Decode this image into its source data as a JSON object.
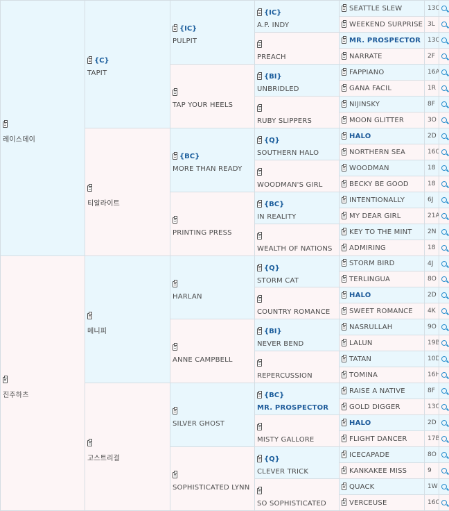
{
  "pedigree": [
    {
      "gen": 1,
      "idx": 0,
      "name": "레이스데이",
      "tag": "",
      "sex": "m",
      "hl": false
    },
    {
      "gen": 1,
      "idx": 1,
      "name": "진주하츠",
      "tag": "",
      "sex": "f",
      "hl": false
    },
    {
      "gen": 2,
      "idx": 0,
      "name": "TAPIT",
      "tag": "{C}",
      "sex": "m",
      "hl": false
    },
    {
      "gen": 2,
      "idx": 1,
      "name": "티알라이트",
      "tag": "",
      "sex": "f",
      "hl": false
    },
    {
      "gen": 2,
      "idx": 2,
      "name": "메니피",
      "tag": "",
      "sex": "m",
      "hl": false
    },
    {
      "gen": 2,
      "idx": 3,
      "name": "고스트리걸",
      "tag": "",
      "sex": "f",
      "hl": false
    },
    {
      "gen": 3,
      "idx": 0,
      "name": "PULPIT",
      "tag": "{IC}",
      "sex": "m",
      "hl": false
    },
    {
      "gen": 3,
      "idx": 1,
      "name": "TAP YOUR HEELS",
      "tag": "",
      "sex": "f",
      "hl": false
    },
    {
      "gen": 3,
      "idx": 2,
      "name": "MORE THAN READY",
      "tag": "{BC}",
      "sex": "m",
      "hl": false
    },
    {
      "gen": 3,
      "idx": 3,
      "name": "PRINTING PRESS",
      "tag": "",
      "sex": "f",
      "hl": false
    },
    {
      "gen": 3,
      "idx": 4,
      "name": "HARLAN",
      "tag": "",
      "sex": "m",
      "hl": false
    },
    {
      "gen": 3,
      "idx": 5,
      "name": "ANNE CAMPBELL",
      "tag": "",
      "sex": "f",
      "hl": false
    },
    {
      "gen": 3,
      "idx": 6,
      "name": "SILVER GHOST",
      "tag": "",
      "sex": "m",
      "hl": false
    },
    {
      "gen": 3,
      "idx": 7,
      "name": "SOPHISTICATED LYNN",
      "tag": "",
      "sex": "f",
      "hl": false
    },
    {
      "gen": 4,
      "idx": 0,
      "name": "A.P. INDY",
      "tag": "{IC}",
      "sex": "m",
      "hl": false
    },
    {
      "gen": 4,
      "idx": 1,
      "name": "PREACH",
      "tag": "",
      "sex": "f",
      "hl": false
    },
    {
      "gen": 4,
      "idx": 2,
      "name": "UNBRIDLED",
      "tag": "{BI}",
      "sex": "m",
      "hl": false
    },
    {
      "gen": 4,
      "idx": 3,
      "name": "RUBY SLIPPERS",
      "tag": "",
      "sex": "f",
      "hl": false
    },
    {
      "gen": 4,
      "idx": 4,
      "name": "SOUTHERN HALO",
      "tag": "{Q}",
      "sex": "m",
      "hl": false
    },
    {
      "gen": 4,
      "idx": 5,
      "name": "WOODMAN'S GIRL",
      "tag": "",
      "sex": "f",
      "hl": false
    },
    {
      "gen": 4,
      "idx": 6,
      "name": "IN REALITY",
      "tag": "{BC}",
      "sex": "m",
      "hl": false
    },
    {
      "gen": 4,
      "idx": 7,
      "name": "WEALTH OF NATIONS",
      "tag": "",
      "sex": "f",
      "hl": false
    },
    {
      "gen": 4,
      "idx": 8,
      "name": "STORM CAT",
      "tag": "{Q}",
      "sex": "m",
      "hl": false
    },
    {
      "gen": 4,
      "idx": 9,
      "name": "COUNTRY ROMANCE",
      "tag": "",
      "sex": "f",
      "hl": false
    },
    {
      "gen": 4,
      "idx": 10,
      "name": "NEVER BEND",
      "tag": "{BI}",
      "sex": "m",
      "hl": false
    },
    {
      "gen": 4,
      "idx": 11,
      "name": "REPERCUSSION",
      "tag": "",
      "sex": "f",
      "hl": false
    },
    {
      "gen": 4,
      "idx": 12,
      "name": "MR. PROSPECTOR",
      "tag": "{BC}",
      "sex": "m",
      "hl": true
    },
    {
      "gen": 4,
      "idx": 13,
      "name": "MISTY GALLORE",
      "tag": "",
      "sex": "f",
      "hl": false
    },
    {
      "gen": 4,
      "idx": 14,
      "name": "CLEVER TRICK",
      "tag": "{Q}",
      "sex": "m",
      "hl": false
    },
    {
      "gen": 4,
      "idx": 15,
      "name": "SO SOPHISTICATED",
      "tag": "",
      "sex": "f",
      "hl": false
    },
    {
      "gen": 5,
      "idx": 0,
      "name": "SEATTLE SLEW",
      "tag": "",
      "sex": "m",
      "hl": false,
      "code": "13C"
    },
    {
      "gen": 5,
      "idx": 1,
      "name": "WEEKEND SURPRISE",
      "tag": "",
      "sex": "f",
      "hl": false,
      "code": "3L"
    },
    {
      "gen": 5,
      "idx": 2,
      "name": "MR. PROSPECTOR",
      "tag": "",
      "sex": "m",
      "hl": true,
      "code": "13C"
    },
    {
      "gen": 5,
      "idx": 3,
      "name": "NARRATE",
      "tag": "",
      "sex": "f",
      "hl": false,
      "code": "2F"
    },
    {
      "gen": 5,
      "idx": 4,
      "name": "FAPPIANO",
      "tag": "",
      "sex": "m",
      "hl": false,
      "code": "16A"
    },
    {
      "gen": 5,
      "idx": 5,
      "name": "GANA FACIL",
      "tag": "",
      "sex": "f",
      "hl": false,
      "code": "1R"
    },
    {
      "gen": 5,
      "idx": 6,
      "name": "NIJINSKY",
      "tag": "",
      "sex": "m",
      "hl": false,
      "code": "8F"
    },
    {
      "gen": 5,
      "idx": 7,
      "name": "MOON GLITTER",
      "tag": "",
      "sex": "f",
      "hl": false,
      "code": "3O"
    },
    {
      "gen": 5,
      "idx": 8,
      "name": "HALO",
      "tag": "",
      "sex": "m",
      "hl": true,
      "code": "2D"
    },
    {
      "gen": 5,
      "idx": 9,
      "name": "NORTHERN SEA",
      "tag": "",
      "sex": "f",
      "hl": false,
      "code": "16C"
    },
    {
      "gen": 5,
      "idx": 10,
      "name": "WOODMAN",
      "tag": "",
      "sex": "m",
      "hl": false,
      "code": "18"
    },
    {
      "gen": 5,
      "idx": 11,
      "name": "BECKY BE GOOD",
      "tag": "",
      "sex": "f",
      "hl": false,
      "code": "18"
    },
    {
      "gen": 5,
      "idx": 12,
      "name": "INTENTIONALLY",
      "tag": "",
      "sex": "m",
      "hl": false,
      "code": "6J"
    },
    {
      "gen": 5,
      "idx": 13,
      "name": "MY DEAR GIRL",
      "tag": "",
      "sex": "f",
      "hl": false,
      "code": "21A"
    },
    {
      "gen": 5,
      "idx": 14,
      "name": "KEY TO THE MINT",
      "tag": "",
      "sex": "m",
      "hl": false,
      "code": "2N"
    },
    {
      "gen": 5,
      "idx": 15,
      "name": "ADMIRING",
      "tag": "",
      "sex": "f",
      "hl": false,
      "code": "18"
    },
    {
      "gen": 5,
      "idx": 16,
      "name": "STORM BIRD",
      "tag": "",
      "sex": "m",
      "hl": false,
      "code": "4J"
    },
    {
      "gen": 5,
      "idx": 17,
      "name": "TERLINGUA",
      "tag": "",
      "sex": "f",
      "hl": false,
      "code": "8O"
    },
    {
      "gen": 5,
      "idx": 18,
      "name": "HALO",
      "tag": "",
      "sex": "m",
      "hl": true,
      "code": "2D"
    },
    {
      "gen": 5,
      "idx": 19,
      "name": "SWEET ROMANCE",
      "tag": "",
      "sex": "f",
      "hl": false,
      "code": "4K"
    },
    {
      "gen": 5,
      "idx": 20,
      "name": "NASRULLAH",
      "tag": "",
      "sex": "m",
      "hl": false,
      "code": "9O"
    },
    {
      "gen": 5,
      "idx": 21,
      "name": "LALUN",
      "tag": "",
      "sex": "f",
      "hl": false,
      "code": "19B"
    },
    {
      "gen": 5,
      "idx": 22,
      "name": "TATAN",
      "tag": "",
      "sex": "m",
      "hl": false,
      "code": "10D"
    },
    {
      "gen": 5,
      "idx": 23,
      "name": "TOMINA",
      "tag": "",
      "sex": "f",
      "hl": false,
      "code": "16H"
    },
    {
      "gen": 5,
      "idx": 24,
      "name": "RAISE A NATIVE",
      "tag": "",
      "sex": "m",
      "hl": false,
      "code": "8F"
    },
    {
      "gen": 5,
      "idx": 25,
      "name": "GOLD DIGGER",
      "tag": "",
      "sex": "f",
      "hl": false,
      "code": "13C"
    },
    {
      "gen": 5,
      "idx": 26,
      "name": "HALO",
      "tag": "",
      "sex": "m",
      "hl": true,
      "code": "2D"
    },
    {
      "gen": 5,
      "idx": 27,
      "name": "FLIGHT DANCER",
      "tag": "",
      "sex": "f",
      "hl": false,
      "code": "17B"
    },
    {
      "gen": 5,
      "idx": 28,
      "name": "ICECAPADE",
      "tag": "",
      "sex": "m",
      "hl": false,
      "code": "8O"
    },
    {
      "gen": 5,
      "idx": 29,
      "name": "KANKAKEE MISS",
      "tag": "",
      "sex": "f",
      "hl": false,
      "code": "9"
    },
    {
      "gen": 5,
      "idx": 30,
      "name": "QUACK",
      "tag": "",
      "sex": "m",
      "hl": false,
      "code": "1W"
    },
    {
      "gen": 5,
      "idx": 31,
      "name": "VERCEUSE",
      "tag": "",
      "sex": "f",
      "hl": false,
      "code": "16C"
    }
  ],
  "icons": {
    "record": "clipboard-icon",
    "search": "magnifier-icon"
  }
}
